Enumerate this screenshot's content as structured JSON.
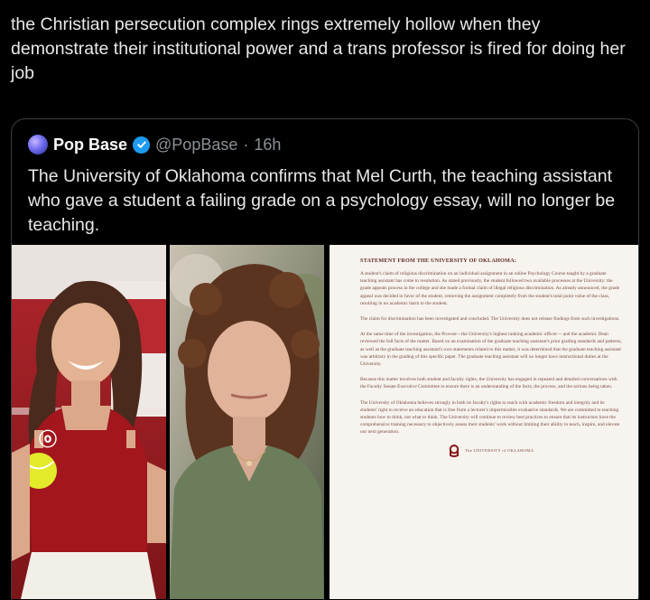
{
  "post": {
    "text": "the Christian persecution complex rings extremely hollow when they demonstrate their institutional power and a trans professor is fired for doing her job"
  },
  "quote": {
    "name": "Pop Base",
    "handle": "@PopBase",
    "dot": "·",
    "time": "16h",
    "text": "The University of Oklahoma confirms that Mel Curth, the teaching assistant who gave a student a failing grade on a psychology essay, will no longer be teaching.",
    "verified_color": "#1d9bf0"
  },
  "statement": {
    "title": "STATEMENT FROM THE UNIVERSITY OF OKLAHOMA:",
    "paragraphs": [
      "A student's claim of religious discrimination on an individual assignment in an online Psychology Course taught by a graduate teaching assistant has come to resolution. As stated previously, the student followed two available processes at the University: the grade appeals process in the college and she made a formal claim of illegal religious discrimination. As already announced, the grade appeal was decided in favor of the student, removing the assignment completely from the student's total point value of the class, resulting in no academic harm to the student.",
      "The claim for discrimination has been investigated and concluded. The University does not release findings from such investigations.",
      "At the same time of the investigation, the Provost—the University's highest ranking academic officer— and the academic Dean reviewed the full facts of the matter. Based on an examination of the graduate teaching assistant's prior grading standards and patterns, as well as the graduate teaching assistant's own statements related to this matter, it was determined that the graduate teaching assistant was arbitrary in the grading of this specific paper. The graduate teaching assistant will no longer have instructional duties at the University.",
      "Because this matter involves both student and faculty rights, the University has engaged in repeated and detailed conversations with the Faculty Senate Executive Committee to ensure there is an understanding of the facts, the process, and the actions being taken.",
      "The University of Oklahoma believes strongly in both its faculty's rights to teach with academic freedom and integrity and its students' right to receive an education that is free from a lecturer's impermissible evaluative standards. We are committed to teaching students how to think, not what to think. The University will continue to review best practices to ensure that its instructors have the comprehensive training necessary to objectively assess their students' work without limiting their ability to teach, inspire, and elevate our next generation."
    ],
    "footer": "The UNIVERSITY of OKLAHOMA",
    "accent": "#841617"
  }
}
